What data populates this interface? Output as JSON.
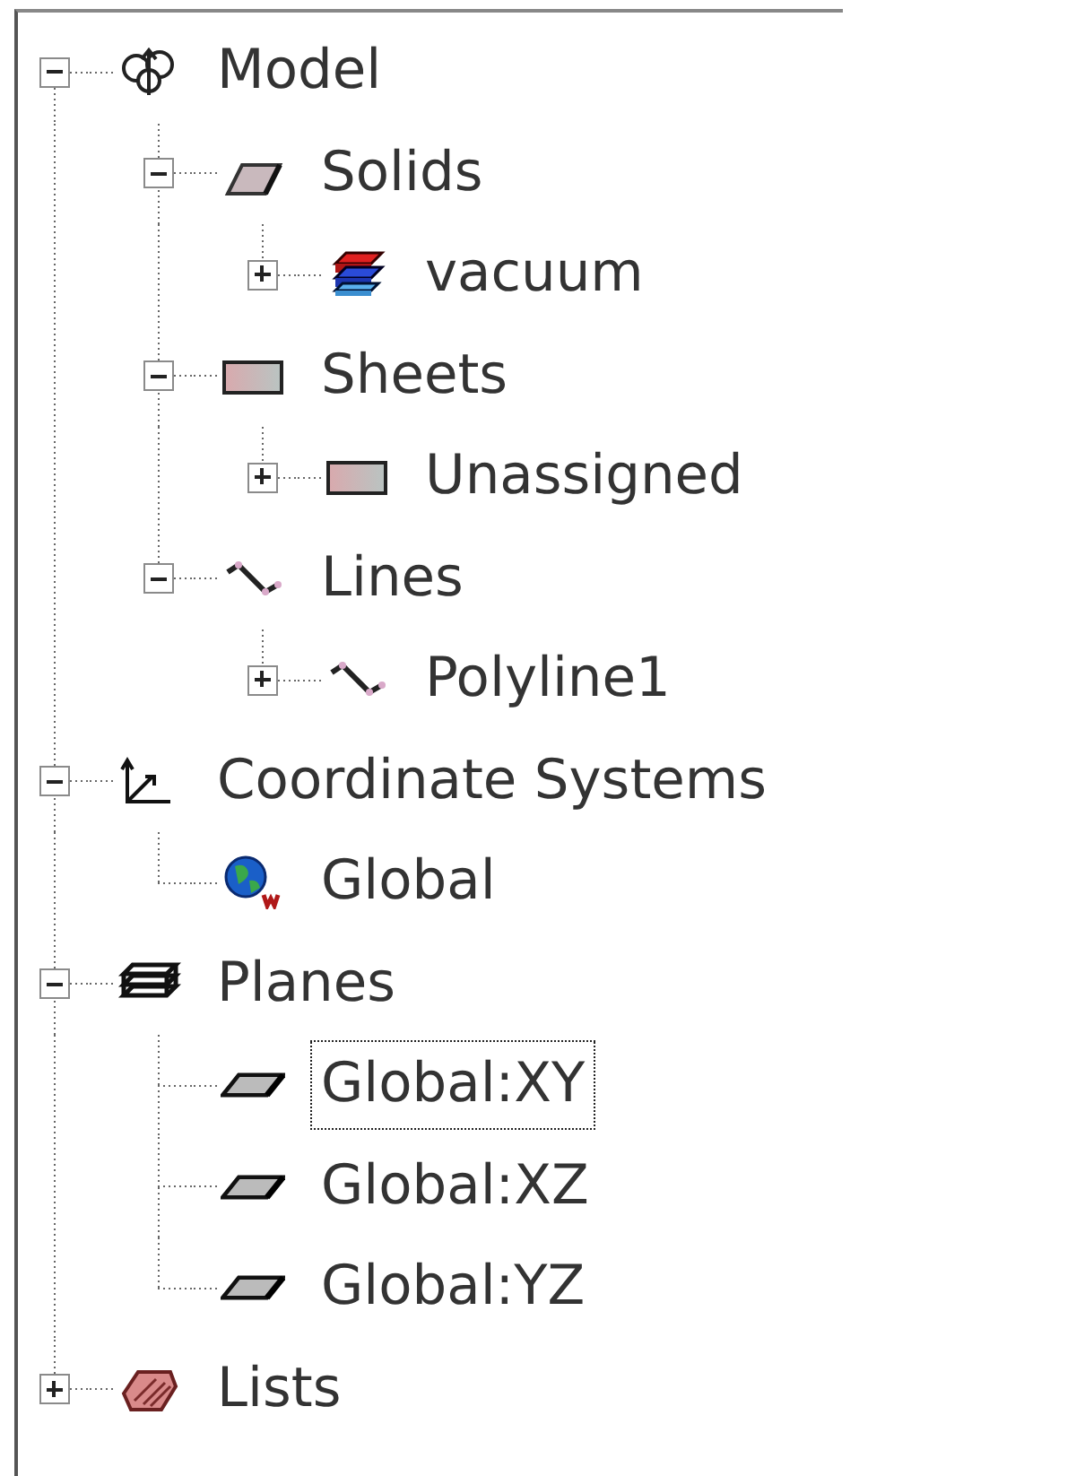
{
  "tree": [
    {
      "label": "Model",
      "kind": "model",
      "expanded": true,
      "selected": false,
      "children": [
        {
          "label": "Solids",
          "kind": "solid",
          "expanded": true,
          "selected": false,
          "children": [
            {
              "label": "vacuum",
              "kind": "material",
              "expanded": false,
              "selected": false
            }
          ]
        },
        {
          "label": "Sheets",
          "kind": "sheet",
          "expanded": true,
          "selected": false,
          "children": [
            {
              "label": "Unassigned",
              "kind": "sheet",
              "expanded": false,
              "selected": false
            }
          ]
        },
        {
          "label": "Lines",
          "kind": "polyline",
          "expanded": true,
          "selected": false,
          "children": [
            {
              "label": "Polyline1",
              "kind": "polyline",
              "expanded": false,
              "selected": false
            }
          ]
        }
      ]
    },
    {
      "label": "Coordinate Systems",
      "kind": "axes",
      "expanded": true,
      "selected": false,
      "children": [
        {
          "label": "Global",
          "kind": "globe",
          "selected": false
        }
      ]
    },
    {
      "label": "Planes",
      "kind": "planes",
      "expanded": true,
      "selected": false,
      "children": [
        {
          "label": "Global:XY",
          "kind": "plane",
          "selected": true
        },
        {
          "label": "Global:XZ",
          "kind": "plane",
          "selected": false
        },
        {
          "label": "Global:YZ",
          "kind": "plane",
          "selected": false
        }
      ]
    },
    {
      "label": "Lists",
      "kind": "lists",
      "expanded": false,
      "selected": false
    }
  ]
}
